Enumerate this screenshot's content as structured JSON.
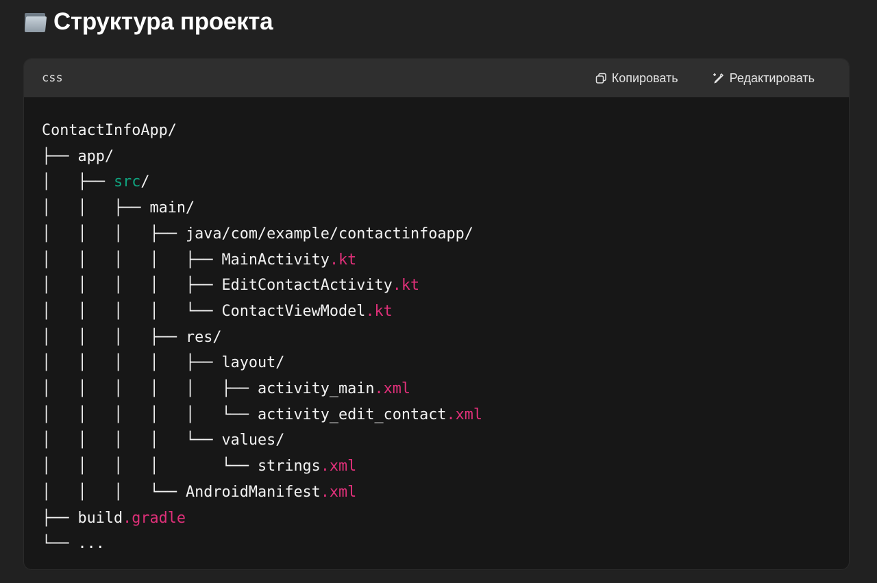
{
  "heading": {
    "icon": "folder-icon",
    "text": "Структура проекта"
  },
  "code_block": {
    "language": "css",
    "copy_label": "Копировать",
    "edit_label": "Редактировать",
    "colors": {
      "background": "#171717",
      "header": "#2f2f2f",
      "green": "#10a37f",
      "pink": "#df3079"
    },
    "lines": [
      [
        {
          "t": "ContactInfoApp/"
        }
      ],
      [
        {
          "t": "├── app/"
        }
      ],
      [
        {
          "t": "│   ├── "
        },
        {
          "t": "src",
          "c": "g"
        },
        {
          "t": "/"
        }
      ],
      [
        {
          "t": "│   │   ├── main/"
        }
      ],
      [
        {
          "t": "│   │   │   ├── java/com/example/contactinfoapp/"
        }
      ],
      [
        {
          "t": "│   │   │   │   ├── MainActivity"
        },
        {
          "t": ".kt",
          "c": "p"
        }
      ],
      [
        {
          "t": "│   │   │   │   ├── EditContactActivity"
        },
        {
          "t": ".kt",
          "c": "p"
        }
      ],
      [
        {
          "t": "│   │   │   │   └── ContactViewModel"
        },
        {
          "t": ".kt",
          "c": "p"
        }
      ],
      [
        {
          "t": "│   │   │   ├── res/"
        }
      ],
      [
        {
          "t": "│   │   │   │   ├── layout/"
        }
      ],
      [
        {
          "t": "│   │   │   │   │   ├── activity_main"
        },
        {
          "t": ".xml",
          "c": "p"
        }
      ],
      [
        {
          "t": "│   │   │   │   │   └── activity_edit_contact"
        },
        {
          "t": ".xml",
          "c": "p"
        }
      ],
      [
        {
          "t": "│   │   │   │   └── values/"
        }
      ],
      [
        {
          "t": "│   │   │   │       └── strings"
        },
        {
          "t": ".xml",
          "c": "p"
        }
      ],
      [
        {
          "t": "│   │   │   └── AndroidManifest"
        },
        {
          "t": ".xml",
          "c": "p"
        }
      ],
      [
        {
          "t": "├── build"
        },
        {
          "t": ".gradle",
          "c": "p"
        }
      ],
      [
        {
          "t": "└── ..."
        }
      ]
    ]
  }
}
